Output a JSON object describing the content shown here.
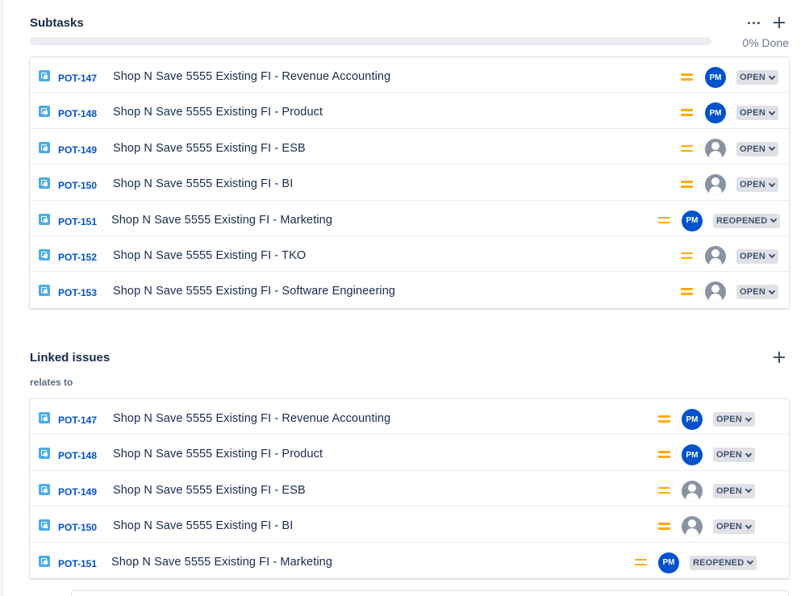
{
  "subtasks": {
    "title": "Subtasks",
    "progress_label": "0% Done",
    "progress_fraction": 0,
    "items": [
      {
        "key": "POT-147",
        "summary": "Shop N Save 5555 Existing FI - Revenue Accounting",
        "assignee": "PM",
        "status": "OPEN"
      },
      {
        "key": "POT-148",
        "summary": "Shop N Save 5555 Existing FI - Product",
        "assignee": "PM",
        "status": "OPEN"
      },
      {
        "key": "POT-149",
        "summary": "Shop N Save 5555 Existing FI - ESB",
        "assignee": "",
        "status": "OPEN"
      },
      {
        "key": "POT-150",
        "summary": "Shop N Save 5555 Existing FI - BI",
        "assignee": "",
        "status": "OPEN"
      },
      {
        "key": "POT-151",
        "summary": "Shop N Save 5555 Existing FI - Marketing",
        "assignee": "PM",
        "status": "REOPENED"
      },
      {
        "key": "POT-152",
        "summary": "Shop N Save 5555 Existing FI - TKO",
        "assignee": "",
        "status": "OPEN"
      },
      {
        "key": "POT-153",
        "summary": "Shop N Save 5555 Existing FI - Software Engineering",
        "assignee": "",
        "status": "OPEN"
      }
    ]
  },
  "linked": {
    "title": "Linked issues",
    "relation": "relates to",
    "items": [
      {
        "key": "POT-147",
        "summary": "Shop N Save 5555 Existing FI - Revenue Accounting",
        "assignee": "PM",
        "status": "OPEN"
      },
      {
        "key": "POT-148",
        "summary": "Shop N Save 5555 Existing FI - Product",
        "assignee": "PM",
        "status": "OPEN"
      },
      {
        "key": "POT-149",
        "summary": "Shop N Save 5555 Existing FI - ESB",
        "assignee": "",
        "status": "OPEN"
      },
      {
        "key": "POT-150",
        "summary": "Shop N Save 5555 Existing FI - BI",
        "assignee": "",
        "status": "OPEN"
      },
      {
        "key": "POT-151",
        "summary": "Shop N Save 5555 Existing FI - Marketing",
        "assignee": "PM",
        "status": "REOPENED"
      }
    ]
  },
  "icons": {
    "issue_type": "subtask-icon",
    "priority": "priority-medium-icon",
    "more": "more-icon",
    "add": "plus-icon",
    "status_dropdown": "chevron-down-icon",
    "unassigned": "default-avatar-icon"
  },
  "colors": {
    "link": "#0052cc",
    "priority_medium": "#ffab00",
    "avatar_pm": "#0052cc",
    "avatar_default": "#8993a4",
    "issue_icon": "#4bade8",
    "status_bg": "#dfe1e6"
  }
}
